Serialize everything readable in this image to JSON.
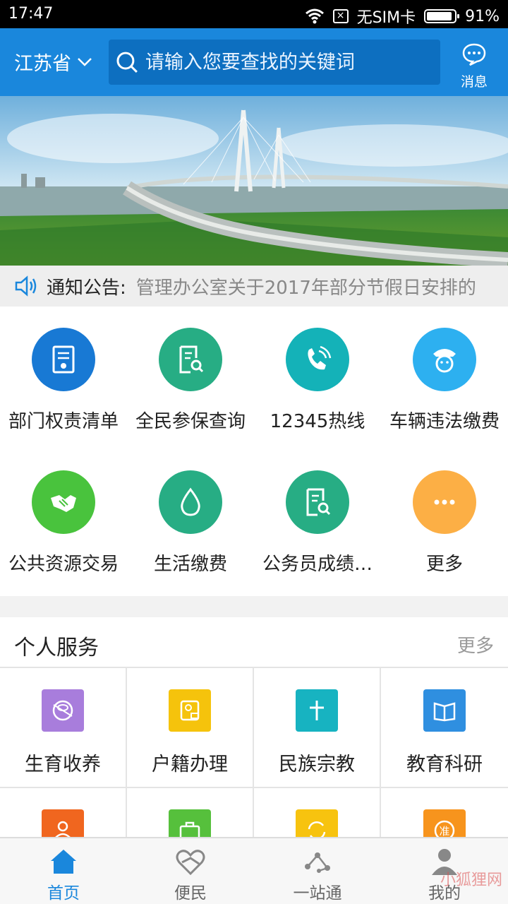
{
  "status_bar": {
    "time": "17:47",
    "sim": "无SIM卡",
    "battery": "91%",
    "battery_level": 0.91
  },
  "header": {
    "province": "江苏省",
    "search_placeholder": "请输入您要查找的关键词",
    "message_label": "消息"
  },
  "notice": {
    "label": "通知公告:",
    "text": "管理办公室关于2017年部分节假日安排的"
  },
  "services": [
    {
      "label": "部门权责清单",
      "color": "#1879d4",
      "icon": "certificate-icon"
    },
    {
      "label": "全民参保查询",
      "color": "#27ad84",
      "icon": "document-search-icon"
    },
    {
      "label": "12345热线",
      "color": "#14b2b8",
      "icon": "phone-icon"
    },
    {
      "label": "车辆违法缴费",
      "color": "#2db0f0",
      "icon": "police-icon"
    },
    {
      "label": "公共资源交易",
      "color": "#49c33d",
      "icon": "handshake-icon"
    },
    {
      "label": "生活缴费",
      "color": "#27ad84",
      "icon": "water-drop-icon"
    },
    {
      "label": "公务员成绩…",
      "color": "#27ad84",
      "icon": "document-search-icon"
    },
    {
      "label": "更多",
      "color": "#fcaf45",
      "icon": "more-dots-icon"
    }
  ],
  "personal": {
    "title": "个人服务",
    "more": "更多",
    "items": [
      {
        "label": "生育收养",
        "color": "#a87ddc",
        "icon": "baby-icon"
      },
      {
        "label": "户籍办理",
        "color": "#f5c30c",
        "icon": "id-card-icon"
      },
      {
        "label": "民族宗教",
        "color": "#17b3c1",
        "icon": "cross-icon"
      },
      {
        "label": "教育科研",
        "color": "#2f8fe0",
        "icon": "book-icon"
      },
      {
        "label": "",
        "color": "#f0661f",
        "icon": "people-icon"
      },
      {
        "label": "",
        "color": "#56c03c",
        "icon": "briefcase-icon"
      },
      {
        "label": "",
        "color": "#f7c30f",
        "icon": "refresh-icon"
      },
      {
        "label": "",
        "color": "#f7941d",
        "icon": "permit-icon"
      }
    ]
  },
  "bottom_nav": [
    {
      "label": "首页",
      "icon": "home-icon",
      "active": true
    },
    {
      "label": "便民",
      "icon": "heart-hands-icon",
      "active": false
    },
    {
      "label": "一站通",
      "icon": "network-icon",
      "active": false
    },
    {
      "label": "我的",
      "icon": "user-icon",
      "active": false
    }
  ],
  "watermark": "小狐狸网"
}
